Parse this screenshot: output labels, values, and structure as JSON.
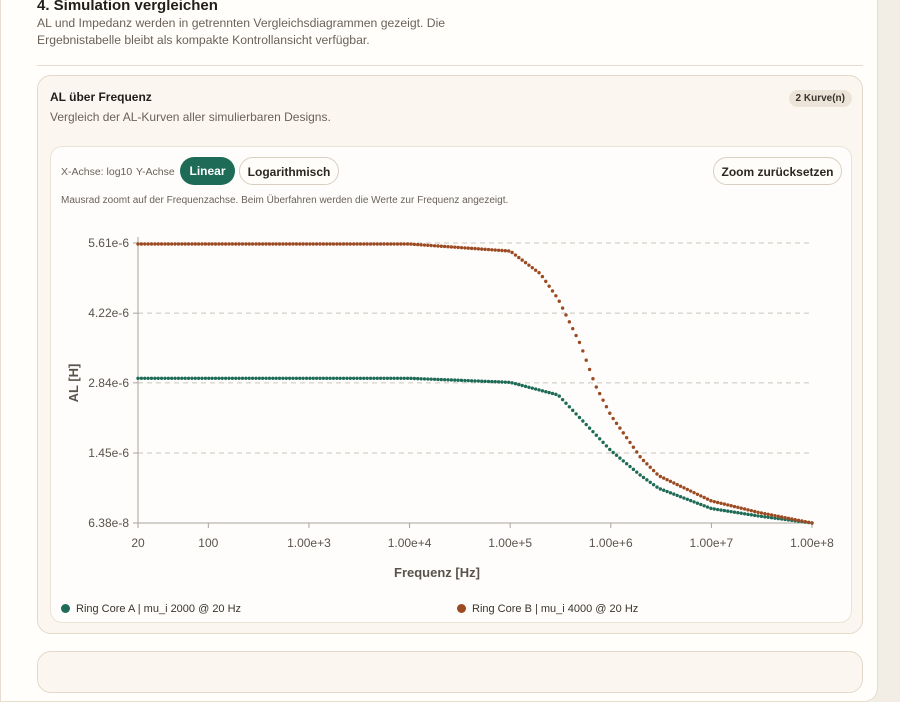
{
  "section": {
    "title": "4. Simulation vergleichen",
    "description": "AL und Impedanz werden in getrennten Vergleichsdiagrammen gezeigt. Die Ergebnistabelle bleibt als kompakte Kontrollansicht verfügbar."
  },
  "card": {
    "title": "AL über Frequenz",
    "subtitle": "Vergleich der AL-Kurven aller simulierbaren Designs.",
    "badge": "2 Kurve(n)"
  },
  "controls": {
    "x_axis_label": "X-Achse: log10",
    "y_axis_label": "Y-Achse",
    "linear": "Linear",
    "logarithmic": "Logarithmisch",
    "reset_zoom": "Zoom zurücksetzen",
    "active_scale": "linear"
  },
  "hint": "Mausrad zoomt auf der Frequenzachse. Beim Überfahren werden die Werte zur Frequenz angezeigt.",
  "colors": {
    "accent": "#1e6b57",
    "series_a": "#1e6b57",
    "series_b": "#9b4a22"
  },
  "chart_data": {
    "type": "scatter",
    "title": "",
    "xlabel": "Frequenz [Hz]",
    "ylabel": "AL [H]",
    "x_scale": "log",
    "xlim": [
      20,
      100000000
    ],
    "ylim": [
      6.38e-08,
      5.61e-06
    ],
    "x_ticks": [
      20,
      100,
      1000,
      10000,
      100000,
      1000000,
      10000000,
      100000000
    ],
    "x_tick_labels": [
      "20",
      "100",
      "1.00e+3",
      "1.00e+4",
      "1.00e+5",
      "1.00e+6",
      "1.00e+7",
      "1.00e+8"
    ],
    "y_ticks": [
      6.38e-08,
      1.45e-06,
      2.84e-06,
      4.22e-06,
      5.61e-06
    ],
    "y_tick_labels": [
      "6.38e-8",
      "1.45e-6",
      "2.84e-6",
      "4.22e-6",
      "5.61e-6"
    ],
    "grid": "horizontal dashed",
    "legend": "bottom",
    "series": [
      {
        "name": "Ring Core A | mu_i 2000 @ 20 Hz",
        "x": [
          20,
          100,
          1000,
          10000,
          100000,
          300000,
          1000000,
          2000000,
          3000000,
          10000000,
          30000000,
          100000000
        ],
        "y": [
          2.93e-06,
          2.93e-06,
          2.93e-06,
          2.93e-06,
          2.85e-06,
          2.6e-06,
          1.5e-06,
          1e-06,
          7.5e-07,
          3.5e-07,
          2e-07,
          6.38e-08
        ]
      },
      {
        "name": "Ring Core B | mu_i 4000 @ 20 Hz",
        "x": [
          20,
          100,
          1000,
          10000,
          100000,
          200000,
          300000,
          500000,
          700000,
          1000000,
          2000000,
          3000000,
          10000000,
          30000000,
          100000000
        ],
        "y": [
          5.59e-06,
          5.59e-06,
          5.59e-06,
          5.59e-06,
          5.45e-06,
          5e-06,
          4.5e-06,
          3.6e-06,
          2.8e-06,
          2.2e-06,
          1.35e-06,
          1e-06,
          5e-07,
          2.7e-07,
          6.38e-08
        ]
      }
    ]
  }
}
